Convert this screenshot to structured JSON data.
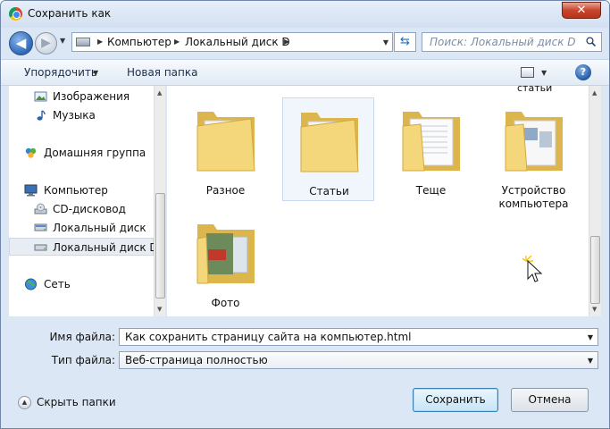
{
  "window": {
    "title": "Сохранить как",
    "close_label": "✕"
  },
  "address": {
    "crumbs": [
      "Компьютер",
      "Локальный диск D"
    ],
    "search_placeholder": "Поиск: Локальный диск D"
  },
  "toolbar": {
    "organize_label": "Упорядочить",
    "new_folder_label": "Новая папка",
    "help_label": "?"
  },
  "sidebar": {
    "items": [
      {
        "label": "Изображения",
        "icon": "pictures-icon"
      },
      {
        "label": "Музыка",
        "icon": "music-icon"
      },
      {
        "label": "Домашняя группа",
        "icon": "homegroup-icon"
      },
      {
        "label": "Компьютер",
        "icon": "computer-icon"
      },
      {
        "label": "CD-дисковод",
        "icon": "cd-drive-icon"
      },
      {
        "label": "Локальный диск",
        "icon": "disk-icon"
      },
      {
        "label": "Локальный диск D",
        "icon": "disk-icon",
        "selected": true
      },
      {
        "label": "Сеть",
        "icon": "network-icon"
      }
    ]
  },
  "content": {
    "cut_label": "статьи",
    "folders": [
      {
        "name": "Разное"
      },
      {
        "name": "Статьи",
        "hover": true
      },
      {
        "name": "Теще"
      },
      {
        "name_line1": "Устройство",
        "name_line2": "компьютера"
      },
      {
        "name": "Фото"
      }
    ]
  },
  "form": {
    "filename_label": "Имя файла:",
    "filename_value": "Как сохранить страницу сайта на компьютер.html",
    "filetype_label": "Тип файла:",
    "filetype_value": "Веб-страница полностью"
  },
  "footer": {
    "hide_folders_label": "Скрыть папки",
    "save_label": "Сохранить",
    "cancel_label": "Отмена"
  },
  "colors": {
    "folder": "#f4d77a",
    "folder_dark": "#dcb64c",
    "accent": "#3c7fb1",
    "close": "#c9452d"
  }
}
